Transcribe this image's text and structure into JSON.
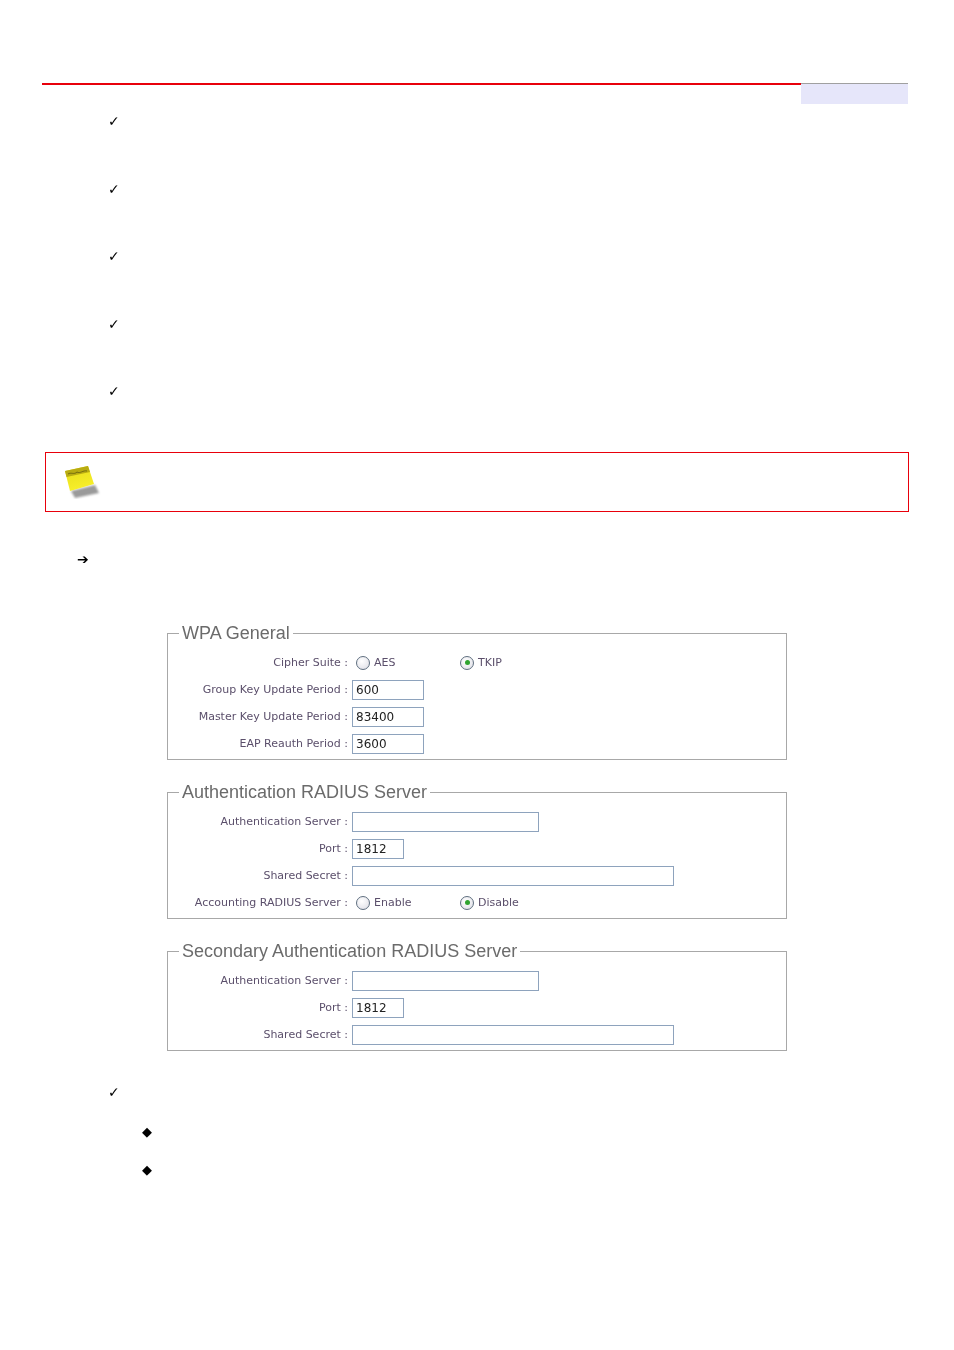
{
  "blocks": [
    {
      "kind": "check",
      "mark": "✓"
    },
    {
      "kind": "check",
      "mark": "✓"
    },
    {
      "kind": "check",
      "mark": "✓"
    },
    {
      "kind": "check",
      "mark": "✓"
    },
    {
      "kind": "check",
      "mark": "✓"
    },
    {
      "kind": "note"
    },
    {
      "kind": "arrow",
      "mark": "➔"
    },
    {
      "kind": "panel",
      "legend": "WPA General",
      "rows": [
        {
          "kind": "radio",
          "label": "Cipher Suite :",
          "options": [
            {
              "label": "AES",
              "selected": false
            },
            {
              "label": "TKIP",
              "selected": true
            }
          ]
        },
        {
          "kind": "number",
          "label": "Group Key Update Period :",
          "value": "600"
        },
        {
          "kind": "number",
          "label": "Master Key Update Period :",
          "value": "83400"
        },
        {
          "kind": "number",
          "label": "EAP Reauth Period :",
          "value": "3600"
        }
      ]
    },
    {
      "kind": "panel",
      "legend": "Authentication RADIUS Server",
      "rows": [
        {
          "kind": "server",
          "label": "Authentication Server :"
        },
        {
          "kind": "port",
          "label": "Port :",
          "value": "1812"
        },
        {
          "kind": "secret",
          "label": "Shared Secret :"
        },
        {
          "kind": "radio",
          "label": "Accounting RADIUS Server :",
          "options": [
            {
              "label": "Enable",
              "selected": false
            },
            {
              "label": "Disable",
              "selected": true
            }
          ]
        }
      ]
    },
    {
      "kind": "panel",
      "legend": "Secondary Authentication RADIUS Server",
      "rows": [
        {
          "kind": "server",
          "label": "Authentication Server :"
        },
        {
          "kind": "port",
          "label": "Port :",
          "value": "1812"
        },
        {
          "kind": "secret",
          "label": "Shared Secret :"
        }
      ]
    },
    {
      "kind": "check",
      "mark": "✓"
    },
    {
      "kind": "diamond",
      "mark": "◆"
    },
    {
      "kind": "diamond",
      "mark": "◆"
    }
  ]
}
